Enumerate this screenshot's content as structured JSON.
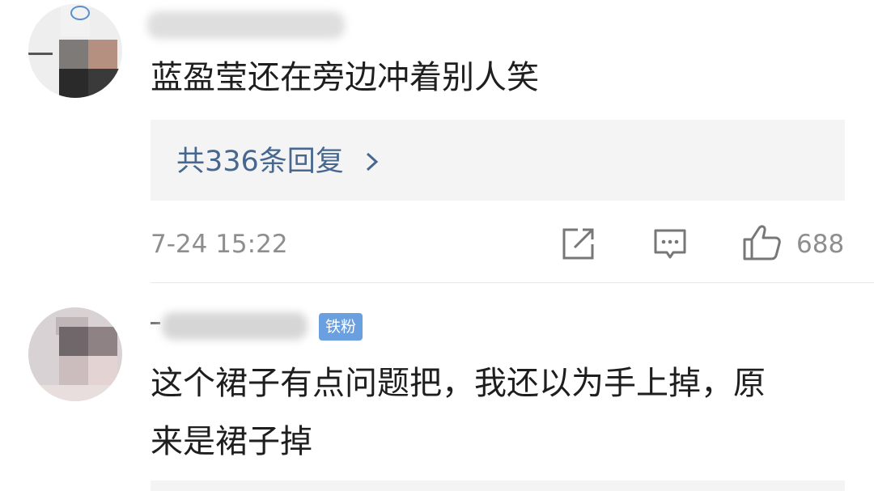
{
  "comments": [
    {
      "text": "蓝盈莹还在旁边冲着别人笑",
      "replies_label": "共336条回复",
      "time": "7-24 15:22",
      "likes": "688",
      "icons": {
        "share": "share-icon",
        "comment": "comment-icon",
        "like": "thumb-up-icon",
        "chevron": "chevron-right-icon"
      }
    },
    {
      "badge": "铁粉",
      "text_line1": "这个裙子有点问题把，我还以为手上掉，原",
      "text_line2": "来是裙子掉"
    }
  ],
  "colors": {
    "link": "#47678f",
    "meta": "#8e8e8e",
    "badge": "#6a9fe0",
    "reply_bg": "#f4f4f4"
  }
}
